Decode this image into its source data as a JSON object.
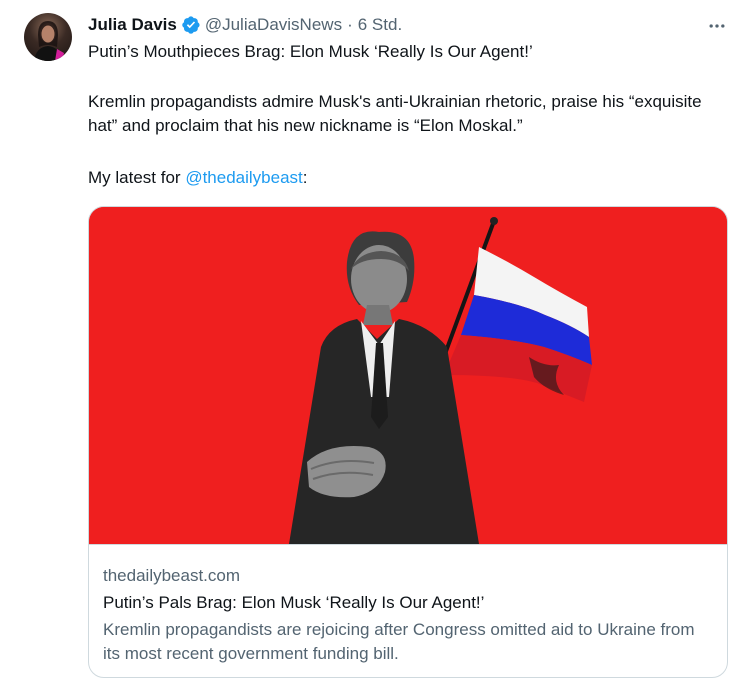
{
  "tweet": {
    "author_name": "Julia Davis",
    "author_handle": "@JuliaDavisNews",
    "separator": "·",
    "timestamp": "6 Std.",
    "more_icon": "more-horizontal-icon",
    "headline": "Putin’s Mouthpieces Brag: Elon Musk ‘Really Is Our Agent!’",
    "body": "Kremlin propagandists admire Musk's anti-Ukrainian rhetoric, praise his “exquisite hat” and proclaim that his new nickname is “Elon Moskal.”",
    "latest_prefix": "My latest for ",
    "mention": "@thedailybeast",
    "latest_suffix": ":"
  },
  "link_card": {
    "domain": "thedailybeast.com",
    "title": "Putin’s Pals Brag: Elon Musk ‘Really Is Our Agent!’",
    "description": "Kremlin propagandists are rejoicing after Congress omitted aid to Ukraine from its most recent government funding bill."
  },
  "colors": {
    "accent": "#1d9bf0",
    "card_background": "#ef1f1f",
    "secondary_text": "#536471"
  }
}
